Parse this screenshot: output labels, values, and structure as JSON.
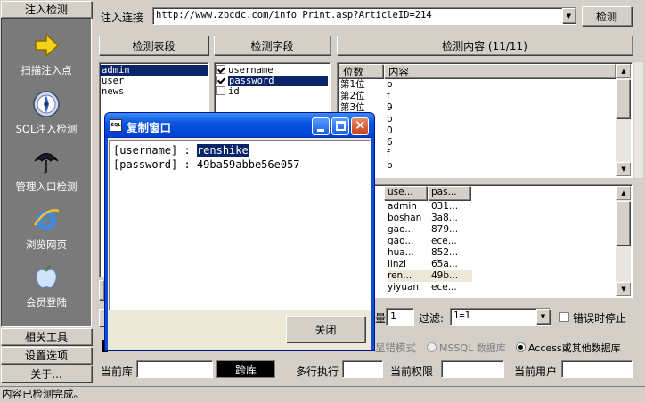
{
  "sidebar": {
    "top_tab": "注入检测",
    "items": [
      {
        "label": "扫描注入点",
        "icon": "arrow-right-icon"
      },
      {
        "label": "SQL注入检测",
        "icon": "compass-icon"
      },
      {
        "label": "管理入口检测",
        "icon": "umbrella-icon"
      },
      {
        "label": "浏览网页",
        "icon": "ie-browser-icon"
      },
      {
        "label": "会员登陆",
        "icon": "apple-icon"
      }
    ],
    "bottom_tabs": [
      "相关工具",
      "设置选项",
      "关于..."
    ]
  },
  "top": {
    "url_label": "注入连接",
    "url_value": "http://www.zbcdc.com/info_Print.asp?ArticleID=214",
    "detect_button": "检测"
  },
  "panels": {
    "tables_header": "检测表段",
    "fields_header": "检测字段",
    "content_header": "检测内容 (11/11)",
    "tables": [
      "admin",
      "user",
      "news"
    ],
    "fields": [
      {
        "name": "username",
        "checked": true
      },
      {
        "name": "password",
        "checked": true
      },
      {
        "name": "id",
        "checked": false
      }
    ]
  },
  "content_grid": {
    "columns": [
      "位数",
      "内容"
    ],
    "rows": [
      [
        "第1位",
        "b"
      ],
      [
        "第2位",
        "f"
      ],
      [
        "第3位",
        "9"
      ],
      [
        "",
        "b"
      ],
      [
        "",
        "0"
      ],
      [
        "",
        "6"
      ],
      [
        "",
        "f"
      ],
      [
        "",
        "b"
      ]
    ]
  },
  "user_grid": {
    "columns": [
      "use...",
      "pas..."
    ],
    "rows": [
      [
        "admin",
        "031..."
      ],
      [
        "boshan",
        "3a8..."
      ],
      [
        "gao...",
        "879..."
      ],
      [
        "gao...",
        "ece..."
      ],
      [
        "hua...",
        "852..."
      ],
      [
        "linzi",
        "65a..."
      ],
      [
        "ren...",
        "49b..."
      ],
      [
        "yiyuan",
        "ece..."
      ]
    ]
  },
  "options": {
    "thread_value": "1",
    "filter_label": "过滤:",
    "filter_value": "1=1",
    "stop_on_error_label": "错误时停止",
    "mode_label": "显错模式",
    "mssql_label": "MSSQL 数据库",
    "access_label": "Access或其他数据库"
  },
  "info_bar": {
    "current_db_label": "当前库",
    "current_db_value": "",
    "action_button": "跨库",
    "multi_exec_label": "多行执行",
    "perm_label": "当前权限",
    "user_label": "当前用户"
  },
  "dialog": {
    "title": "复制窗口",
    "line1_key": "[username] :",
    "line1_value": "renshike",
    "line2": "[password] : 49ba59abbe56e057",
    "close_button": "关闭"
  },
  "status": "内容已检测完成。"
}
